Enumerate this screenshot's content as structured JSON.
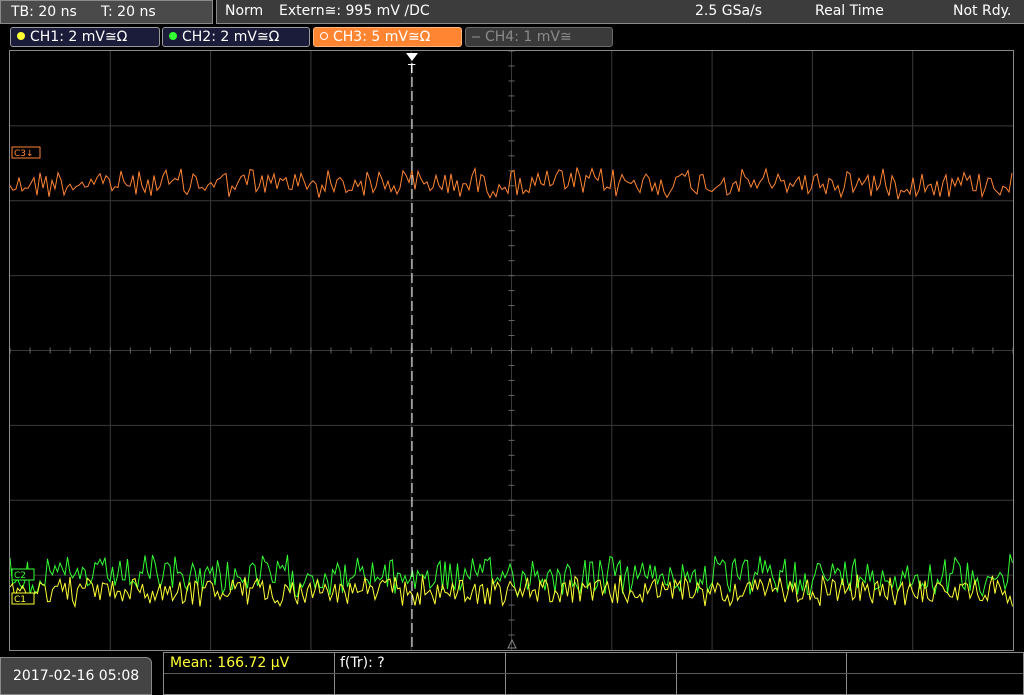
{
  "header": {
    "timebase": "TB: 20 ns",
    "trigger_time": "T: 20 ns",
    "mode": "Norm",
    "trigger_source": "Extern≅: 995 mV ∕DC",
    "sample_rate": "2.5 GSa/s",
    "acq_mode": "Real Time",
    "status": "Not Rdy."
  },
  "channels": [
    {
      "label": "CH1: 2 mV≅Ω",
      "color": "#ffff33"
    },
    {
      "label": "CH2: 2 mV≅Ω",
      "color": "#33ff33"
    },
    {
      "label": "CH3: 5 mV≅Ω",
      "color": "#ff8533"
    },
    {
      "label": "CH4: 1 mV≅",
      "color": "#666666"
    }
  ],
  "markers": {
    "c3": "C3↓",
    "c2": "C2",
    "c1": "C1",
    "trigger": "T"
  },
  "footer": {
    "datetime": "2017-02-16 05:08",
    "mean": "Mean: 166.72 µV",
    "freq": "f(Tr): ?"
  },
  "colors": {
    "grid": "#3a3a3a",
    "accent": "#ffff33"
  }
}
